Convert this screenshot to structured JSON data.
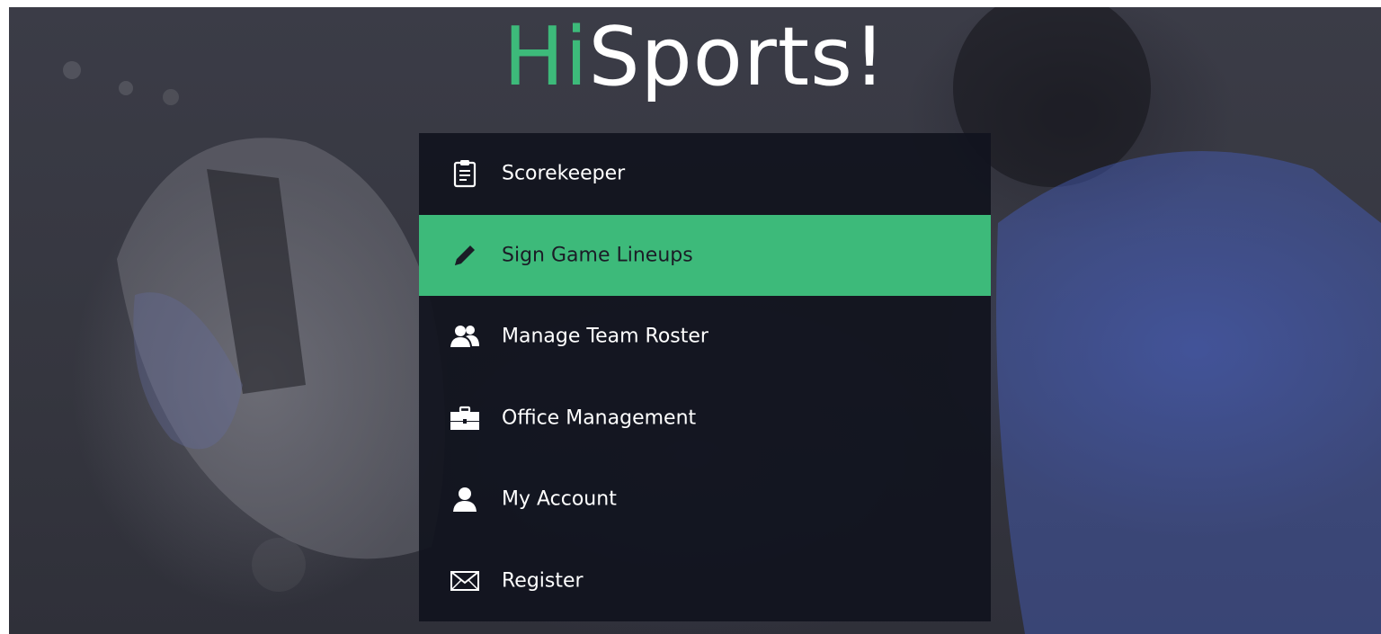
{
  "logo": {
    "part1": "Hi",
    "part2": "Sports!"
  },
  "menu": {
    "items": [
      {
        "label": "Scorekeeper",
        "icon": "clipboard-icon",
        "active": false
      },
      {
        "label": "Sign Game Lineups",
        "icon": "pencil-icon",
        "active": true
      },
      {
        "label": "Manage Team Roster",
        "icon": "users-icon",
        "active": false
      },
      {
        "label": "Office Management",
        "icon": "briefcase-icon",
        "active": false
      },
      {
        "label": "My Account",
        "icon": "user-icon",
        "active": false
      },
      {
        "label": "Register",
        "icon": "envelope-icon",
        "active": false
      }
    ]
  },
  "colors": {
    "accent": "#3dba7a",
    "menu_bg": "#11131e",
    "text": "#ffffff"
  }
}
